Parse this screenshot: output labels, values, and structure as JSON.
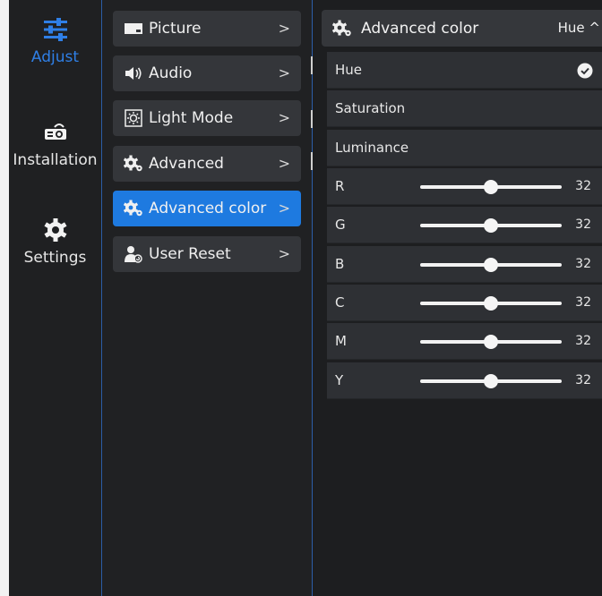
{
  "nav": {
    "items": [
      {
        "label": "Adjust",
        "icon": "sliders-icon",
        "active": true
      },
      {
        "label": "Installation",
        "icon": "projector-icon",
        "active": false
      },
      {
        "label": "Settings",
        "icon": "gear-icon",
        "active": false
      }
    ]
  },
  "menu": {
    "items": [
      {
        "label": "Picture",
        "icon": "picture-icon"
      },
      {
        "label": "Audio",
        "icon": "speaker-icon"
      },
      {
        "label": "Light Mode",
        "icon": "brightness-icon"
      },
      {
        "label": "Advanced",
        "icon": "gears-icon"
      },
      {
        "label": "Advanced color",
        "icon": "gears-icon",
        "active": true
      },
      {
        "label": "User Reset",
        "icon": "user-reset-icon"
      }
    ],
    "chevron": ">"
  },
  "panel": {
    "title": "Advanced color",
    "dropdown": "Hue ^",
    "modes": [
      {
        "label": "Hue",
        "selected": true
      },
      {
        "label": "Saturation",
        "selected": false
      },
      {
        "label": "Luminance",
        "selected": false
      }
    ],
    "sliders": [
      {
        "label": "R",
        "value": "32",
        "level": 0.5
      },
      {
        "label": "G",
        "value": "32",
        "level": 0.5
      },
      {
        "label": "B",
        "value": "32",
        "level": 0.5
      },
      {
        "label": "C",
        "value": "32",
        "level": 0.5
      },
      {
        "label": "M",
        "value": "32",
        "level": 0.5
      },
      {
        "label": "Y",
        "value": "32",
        "level": 0.5
      }
    ]
  },
  "colors": {
    "accent": "#1e7ae0",
    "active_text": "#2f7fe6"
  }
}
